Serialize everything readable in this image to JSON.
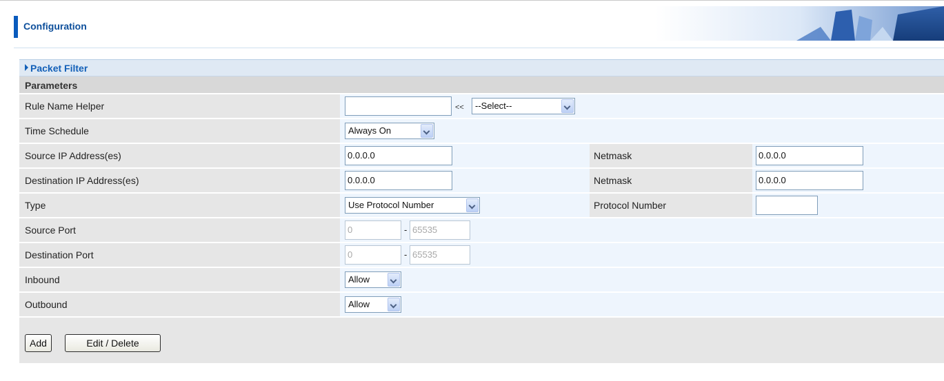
{
  "header": {
    "title": "Configuration"
  },
  "panel": {
    "title": "Packet Filter",
    "section": "Parameters"
  },
  "fields": {
    "rule_name_helper": {
      "label": "Rule Name  Helper",
      "value": "",
      "separator": "<<",
      "select": "--Select--"
    },
    "time_schedule": {
      "label": "Time Schedule",
      "select": "Always On"
    },
    "source_ip": {
      "label": "Source IP Address(es)",
      "value": "0.0.0.0",
      "netmask_label": "Netmask",
      "netmask": "0.0.0.0"
    },
    "destination_ip": {
      "label": "Destination IP Address(es)",
      "value": "0.0.0.0",
      "netmask_label": "Netmask",
      "netmask": "0.0.0.0"
    },
    "type": {
      "label": "Type",
      "select": "Use Protocol Number",
      "protocol_label": "Protocol Number",
      "protocol_value": ""
    },
    "source_port": {
      "label": "Source Port",
      "from": "0",
      "dash": "-",
      "to": "65535"
    },
    "destination_port": {
      "label": "Destination Port",
      "from": "0",
      "dash": "-",
      "to": "65535"
    },
    "inbound": {
      "label": "Inbound",
      "select": "Allow"
    },
    "outbound": {
      "label": "Outbound",
      "select": "Allow"
    }
  },
  "buttons": {
    "add": "Add",
    "edit_delete": "Edit / Delete"
  },
  "icons": {
    "panel_arrow": "triangle-right-icon",
    "dropdown": "chevron-down-icon"
  },
  "colors": {
    "title_blue": "#0d4f9b",
    "accent": "#1360b8",
    "label_bg": "#e6e6e6",
    "field_bg": "#eef5fd"
  }
}
